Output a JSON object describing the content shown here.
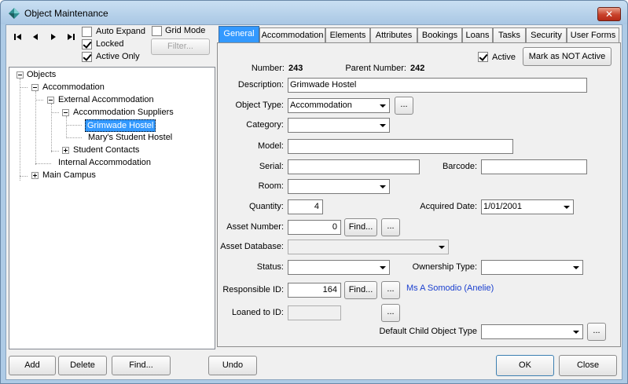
{
  "window": {
    "title": "Object Maintenance",
    "close_glyph": "✕"
  },
  "toolbar": {
    "auto_expand": {
      "label": "Auto Expand",
      "checked": false
    },
    "grid_mode": {
      "label": "Grid Mode",
      "checked": false
    },
    "locked": {
      "label": "Locked",
      "checked": true
    },
    "active_only": {
      "label": "Active Only",
      "checked": true
    },
    "filter_label": "Filter..."
  },
  "tree": {
    "root": "Objects",
    "accommodation": "Accommodation",
    "external_accommodation": "External Accommodation",
    "accommodation_suppliers": "Accommodation Suppliers",
    "grimwade_hostel": "Grimwade Hostel",
    "marys_student_hostel": "Mary's Student Hostel",
    "student_contacts": "Student Contacts",
    "internal_accommodation": "Internal Accommodation",
    "main_campus": "Main Campus"
  },
  "tabs": [
    "General",
    "Accommodation",
    "Elements",
    "Attributes",
    "Bookings",
    "Loans",
    "Tasks",
    "Security",
    "User Forms"
  ],
  "general": {
    "active_label": "Active",
    "active_checked": true,
    "mark_not_active_label": "Mark as NOT Active",
    "number_label": "Number:",
    "number_value": "243",
    "parent_number_label": "Parent Number:",
    "parent_number_value": "242",
    "description_label": "Description:",
    "description_value": "Grimwade Hostel",
    "object_type_label": "Object Type:",
    "object_type_value": "Accommodation",
    "category_label": "Category:",
    "category_value": "",
    "model_label": "Model:",
    "model_value": "",
    "serial_label": "Serial:",
    "serial_value": "",
    "barcode_label": "Barcode:",
    "barcode_value": "",
    "room_label": "Room:",
    "room_value": "",
    "quantity_label": "Quantity:",
    "quantity_value": "4",
    "acquired_date_label": "Acquired Date:",
    "acquired_date_value": "1/01/2001",
    "asset_number_label": "Asset Number:",
    "asset_number_value": "0",
    "find_label": "Find...",
    "ellipsis_label": "...",
    "asset_database_label": "Asset Database:",
    "asset_database_value": "",
    "status_label": "Status:",
    "status_value": "",
    "ownership_type_label": "Ownership Type:",
    "ownership_type_value": "",
    "responsible_id_label": "Responsible ID:",
    "responsible_id_value": "164",
    "responsible_name": "Ms A Somodio (Anelie)",
    "loaned_to_label": "Loaned to ID:",
    "loaned_to_value": "",
    "default_child_label": "Default Child Object Type",
    "default_child_value": ""
  },
  "footer": {
    "add_label": "Add",
    "delete_label": "Delete",
    "find_label": "Find...",
    "undo_label": "Undo",
    "ok_label": "OK",
    "close_label": "Close"
  },
  "colors": {
    "selection": "#3399ff",
    "link": "#1a3fcf",
    "frame": "#aecbe6"
  }
}
